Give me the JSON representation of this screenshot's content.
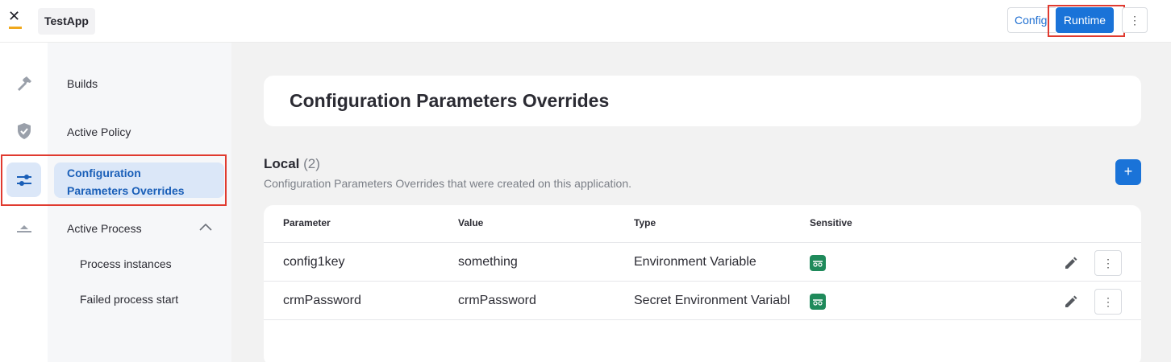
{
  "app": {
    "name": "TestApp",
    "logo_icon": "flowx-logo-icon"
  },
  "header": {
    "tabs": [
      {
        "label": "Config",
        "active": false
      },
      {
        "label": "Runtime",
        "active": true
      }
    ],
    "more_label": "⋮"
  },
  "sidebar": {
    "items": [
      {
        "label": "Builds",
        "icon": "hammer-icon"
      },
      {
        "label": "Active Policy",
        "icon": "shield-icon"
      },
      {
        "label": "Configuration Parameters Overrides",
        "line1": "Configuration",
        "line2": "Parameters Overrides",
        "icon": "sliders-icon",
        "active": true
      },
      {
        "label": "Active Process",
        "icon": "process-icon",
        "expanded": true,
        "children": [
          {
            "label": "Process instances"
          },
          {
            "label": "Failed process start"
          }
        ]
      }
    ]
  },
  "main": {
    "title": "Configuration Parameters Overrides",
    "section": {
      "title": "Local",
      "count": "(2)",
      "subtitle": "Configuration Parameters Overrides that were created on this application.",
      "add_label": "+"
    },
    "table": {
      "columns": [
        "Parameter",
        "Value",
        "Type",
        "Sensitive"
      ],
      "rows": [
        {
          "parameter": "config1key",
          "value": "something",
          "type": "Environment Variable",
          "sensitive": true
        },
        {
          "parameter": "crmPassword",
          "value": "crmPassword",
          "type": "Secret Environment Variable",
          "sensitive": true
        }
      ],
      "row_more_label": "⋮"
    }
  },
  "colors": {
    "accent": "#1a73d8",
    "highlight": "#e03a2f",
    "sensitive": "#1f8a5b"
  }
}
